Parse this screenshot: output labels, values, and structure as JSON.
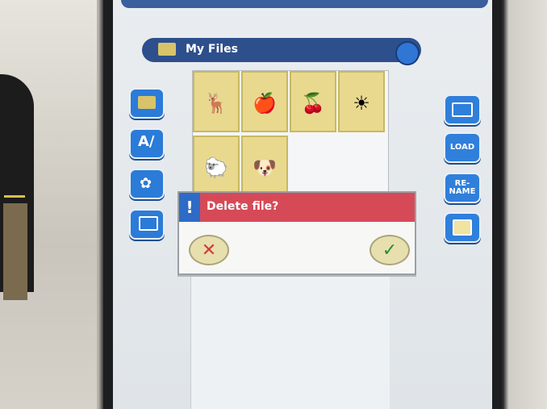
{
  "window": {
    "title": "My Files"
  },
  "grid": {
    "items": [
      {
        "name": "deer"
      },
      {
        "name": "apple"
      },
      {
        "name": "cherry"
      },
      {
        "name": "sun"
      },
      {
        "name": "lamb"
      },
      {
        "name": "puppy"
      }
    ]
  },
  "left_toolbar": [
    {
      "icon": "folder-icon"
    },
    {
      "icon": "text-icon"
    },
    {
      "icon": "flower-icon"
    },
    {
      "icon": "transfer-icon"
    }
  ],
  "right_toolbar": [
    {
      "icon": "folder-icon",
      "label": ""
    },
    {
      "icon": "load-icon",
      "label": "LOAD"
    },
    {
      "icon": "rename-icon",
      "label": "RE-\nNAME"
    },
    {
      "icon": "save-icon",
      "label": ""
    }
  ],
  "dialog": {
    "badge": "!",
    "message": "Delete file?",
    "cancel_icon": "x-icon",
    "confirm_icon": "check-icon"
  },
  "colors": {
    "accent_blue": "#2f7fdb",
    "dialog_red": "#d64a58",
    "grid_tile": "#e8d98f"
  }
}
